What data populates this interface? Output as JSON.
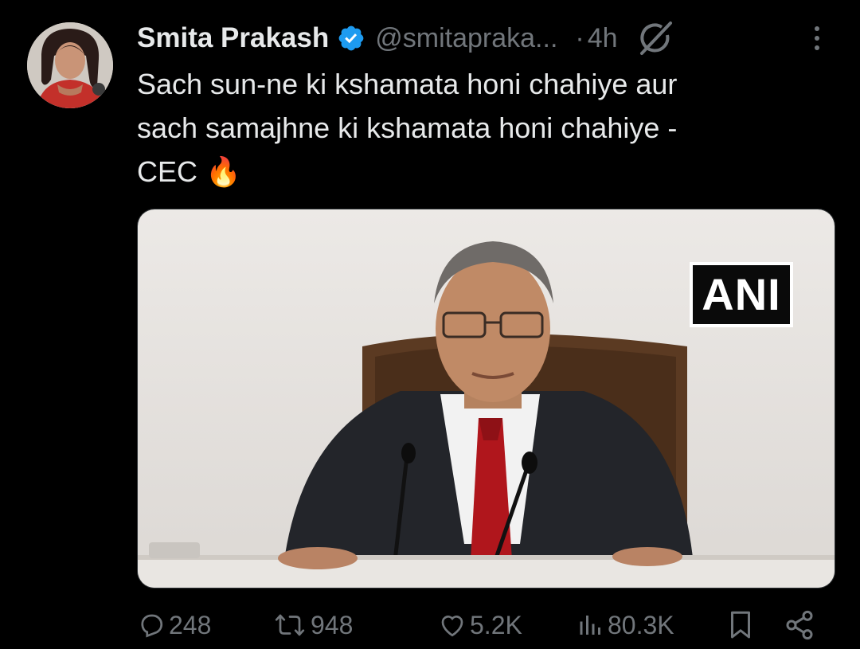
{
  "tweet": {
    "author_name": "Smita Prakash",
    "handle": "@smitapraka...",
    "separator": "·",
    "time": "4h",
    "text": "Sach sun-ne ki kshamata honi chahiye aur\nsach samajhne ki kshamata honi chahiye -\nCEC 🔥",
    "media_watermark": "ANI"
  },
  "actions": {
    "replies": "248",
    "reposts": "948",
    "likes": "5.2K",
    "views": "80.3K"
  },
  "icons": {
    "verified": "verified-badge-icon",
    "grok": "grok-icon",
    "more": "more-options-icon",
    "reply": "reply-icon",
    "repost": "repost-icon",
    "like": "like-icon",
    "views": "views-icon",
    "bookmark": "bookmark-icon",
    "share": "share-icon"
  },
  "colors": {
    "background": "#000000",
    "primary_text": "#e7e9ea",
    "secondary_text": "#71767b",
    "verified": "#1d9bf0"
  }
}
